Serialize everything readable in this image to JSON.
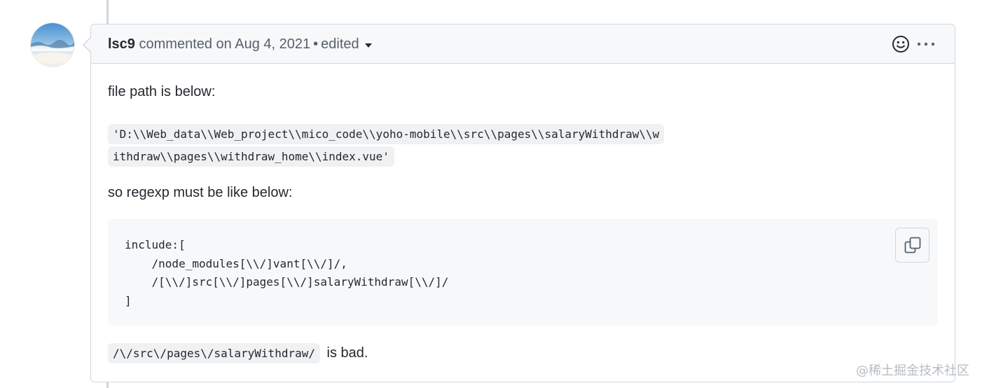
{
  "comment": {
    "author": "lsc9",
    "action_text": "commented on",
    "date": "Aug 4, 2021",
    "separator": "•",
    "edited_label": "edited",
    "emoji_icon": "smiley-icon",
    "more_icon": "kebab-horizontal-icon"
  },
  "body": {
    "paragraph1": "file path is below:",
    "file_path": "'D:\\\\Web_data\\\\Web_project\\\\mico_code\\\\yoho-mobile\\\\src\\\\pages\\\\salaryWithdraw\\\\withdraw\\\\pages\\\\withdraw_home\\\\index.vue'",
    "paragraph2": "so regexp must be like below:",
    "code_block": "include:[\n    /node_modules[\\\\/]vant[\\\\/]/,\n    /[\\\\/]src[\\\\/]pages[\\\\/]salaryWithdraw[\\\\/]/\n]",
    "copy_icon": "copy-icon",
    "bad_code": "/\\/src\\/pages\\/salaryWithdraw/",
    "bad_suffix": "is bad."
  },
  "watermark": "@稀土掘金技术社区"
}
